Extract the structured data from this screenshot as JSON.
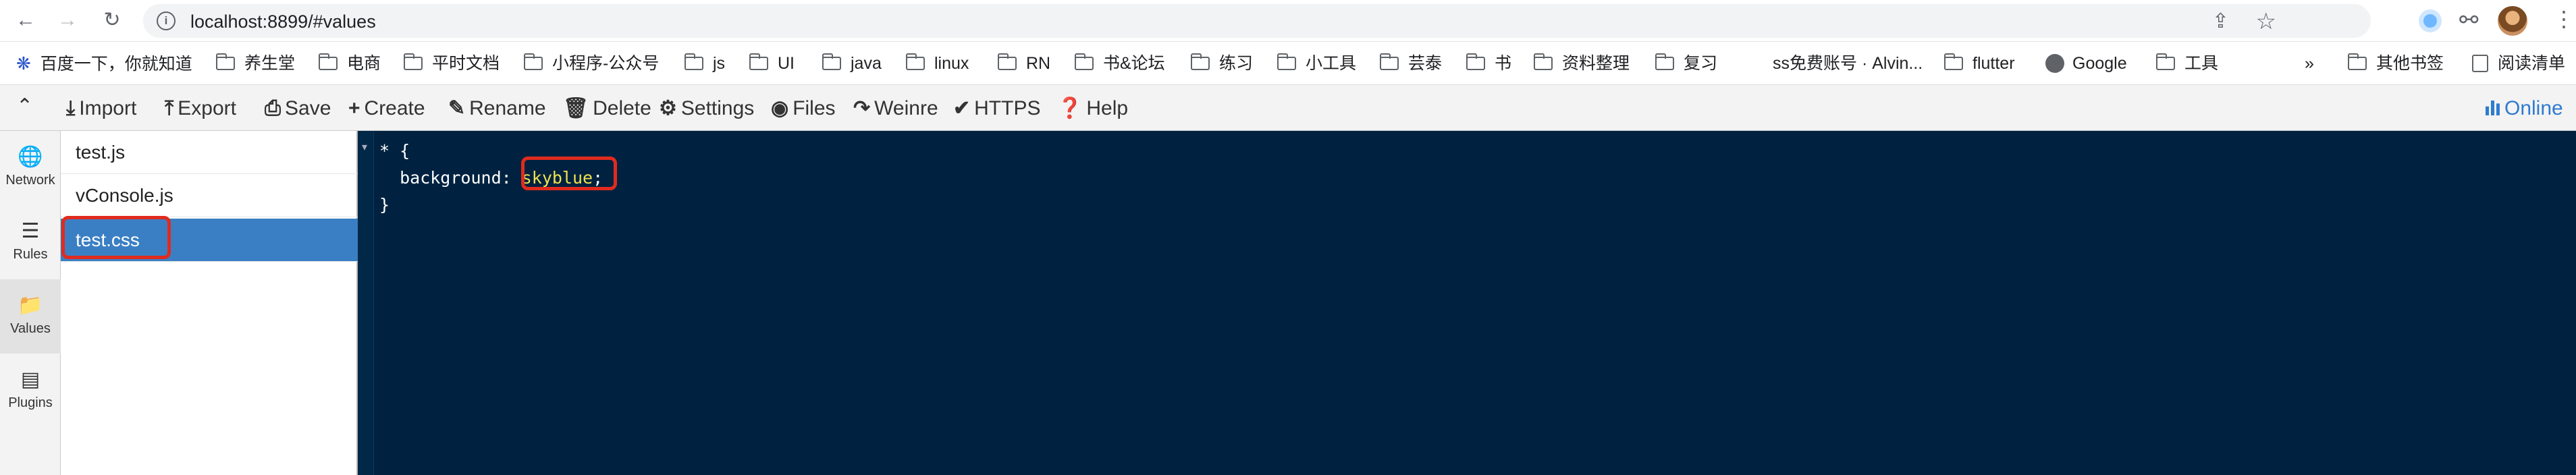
{
  "browser": {
    "url": "localhost:8899/#values"
  },
  "bookmarks": [
    {
      "label": "百度一下，你就知道",
      "icon": "paw-icon"
    },
    {
      "label": "养生堂",
      "icon": "folder-icon"
    },
    {
      "label": "电商",
      "icon": "folder-icon"
    },
    {
      "label": "平时文档",
      "icon": "folder-icon"
    },
    {
      "label": "小程序-公众号",
      "icon": "folder-icon"
    },
    {
      "label": "js",
      "icon": "folder-icon"
    },
    {
      "label": "UI",
      "icon": "folder-icon"
    },
    {
      "label": "java",
      "icon": "folder-icon"
    },
    {
      "label": "linux",
      "icon": "folder-icon"
    },
    {
      "label": "RN",
      "icon": "folder-icon"
    },
    {
      "label": "书&论坛",
      "icon": "folder-icon"
    },
    {
      "label": "练习",
      "icon": "folder-icon"
    },
    {
      "label": "小工具",
      "icon": "folder-icon"
    },
    {
      "label": "芸泰",
      "icon": "folder-icon"
    },
    {
      "label": "书",
      "icon": "folder-icon"
    },
    {
      "label": "资料整理",
      "icon": "folder-icon"
    },
    {
      "label": "复习",
      "icon": "folder-icon"
    },
    {
      "label": "ss免费账号 · Alvin...",
      "icon": "none"
    },
    {
      "label": "flutter",
      "icon": "folder-icon"
    },
    {
      "label": "Google",
      "icon": "globe-icon"
    },
    {
      "label": "工具",
      "icon": "folder-icon"
    }
  ],
  "bookmarks_overflow": "»",
  "bookmarks_other": "其他书签",
  "reading_list": "阅读清单",
  "toolbar": {
    "import": "Import",
    "export": "Export",
    "save": "Save",
    "create": "Create",
    "rename": "Rename",
    "delete": "Delete",
    "settings": "Settings",
    "files": "Files",
    "weinre": "Weinre",
    "https": "HTTPS",
    "help": "Help",
    "online": "Online"
  },
  "leftnav": [
    {
      "label": "Network",
      "icon": "globe-icon"
    },
    {
      "label": "Rules",
      "icon": "list-icon"
    },
    {
      "label": "Values",
      "icon": "folder-icon"
    },
    {
      "label": "Plugins",
      "icon": "document-icon"
    }
  ],
  "leftnav_active": "Values",
  "files": [
    "test.js",
    "vConsole.js",
    "test.css"
  ],
  "selected_file": "test.css",
  "editor": {
    "line1": "* {",
    "line2_prop": "  background: ",
    "line2_value": "skyblue",
    "line2_end": ";",
    "line3": "}"
  }
}
